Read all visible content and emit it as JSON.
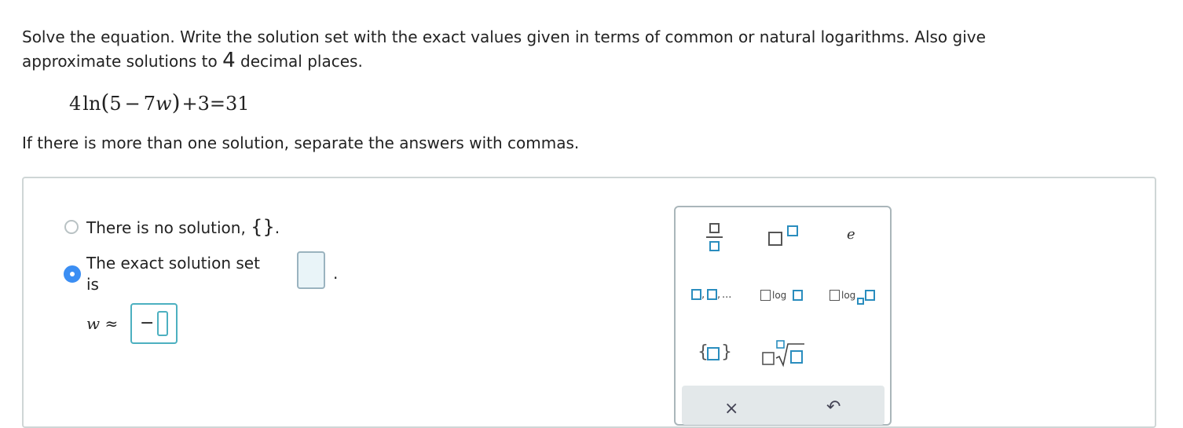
{
  "question": {
    "line1": "Solve the equation. Write the solution set with the exact values given in terms of common or natural logarithms. Also give",
    "line2_pre": "approximate solutions to ",
    "line2_num": "4",
    "line2_post": " decimal places.",
    "equation": {
      "coef": "4",
      "fn": "ln",
      "open": "(",
      "inner_a": "5",
      "op1": "−",
      "inner_b": "7",
      "var": "w",
      "close": ")",
      "plus": "+3",
      "eq": "=31"
    },
    "instruction": "If there is more than one solution, separate the answers with commas."
  },
  "answer": {
    "option_no_solution": "There is no solution, ",
    "empty_set": "{}",
    "period": ".",
    "option_exact_line1": "The exact solution set",
    "option_exact_line2": "is",
    "selected_option": "exact",
    "approx_var": "w",
    "approx_symbol": "≈",
    "approx_minus": "−"
  },
  "palette": {
    "e_label": "e",
    "list_label": ",",
    "ellipsis": "...",
    "log_label": "log",
    "log_base_label": "log",
    "set_open": "{",
    "set_close": "}",
    "clear_icon": "×",
    "undo_icon": "↶"
  }
}
